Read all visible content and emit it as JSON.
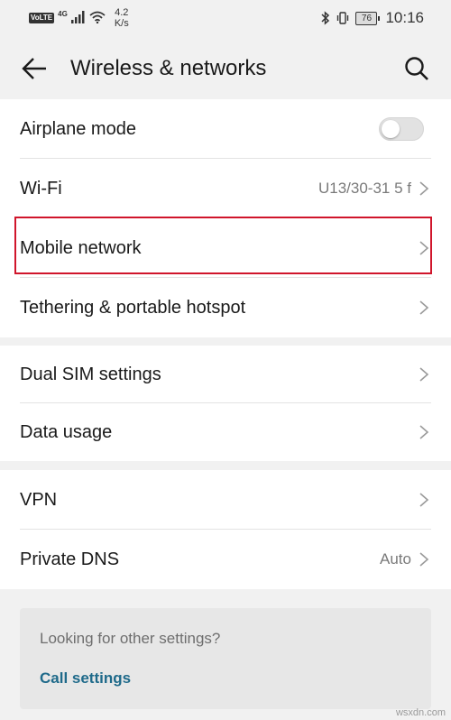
{
  "status_bar": {
    "volte": "VoLTE",
    "network": "4G",
    "speed_value": "4.2",
    "speed_unit": "K/s",
    "battery": "76",
    "time": "10:16"
  },
  "app_bar": {
    "title": "Wireless & networks",
    "back_icon": "arrow-left-icon",
    "search_icon": "search-icon"
  },
  "group1": [
    {
      "label": "Airplane mode",
      "toggle": false
    },
    {
      "label": "Wi-Fi",
      "value": "U13/30-31 5 f"
    },
    {
      "label": "Mobile network",
      "value": ""
    },
    {
      "label": "Tethering & portable hotspot",
      "value": ""
    }
  ],
  "group2": [
    {
      "label": "Dual SIM settings",
      "value": ""
    },
    {
      "label": "Data usage",
      "value": ""
    }
  ],
  "group3": [
    {
      "label": "VPN",
      "value": ""
    },
    {
      "label": "Private DNS",
      "value": "Auto"
    }
  ],
  "info": {
    "prompt": "Looking for other settings?",
    "link": "Call settings"
  },
  "watermark": "wsxdn.com",
  "colors": {
    "highlight": "#d0152b",
    "link": "#1f6a8a"
  }
}
